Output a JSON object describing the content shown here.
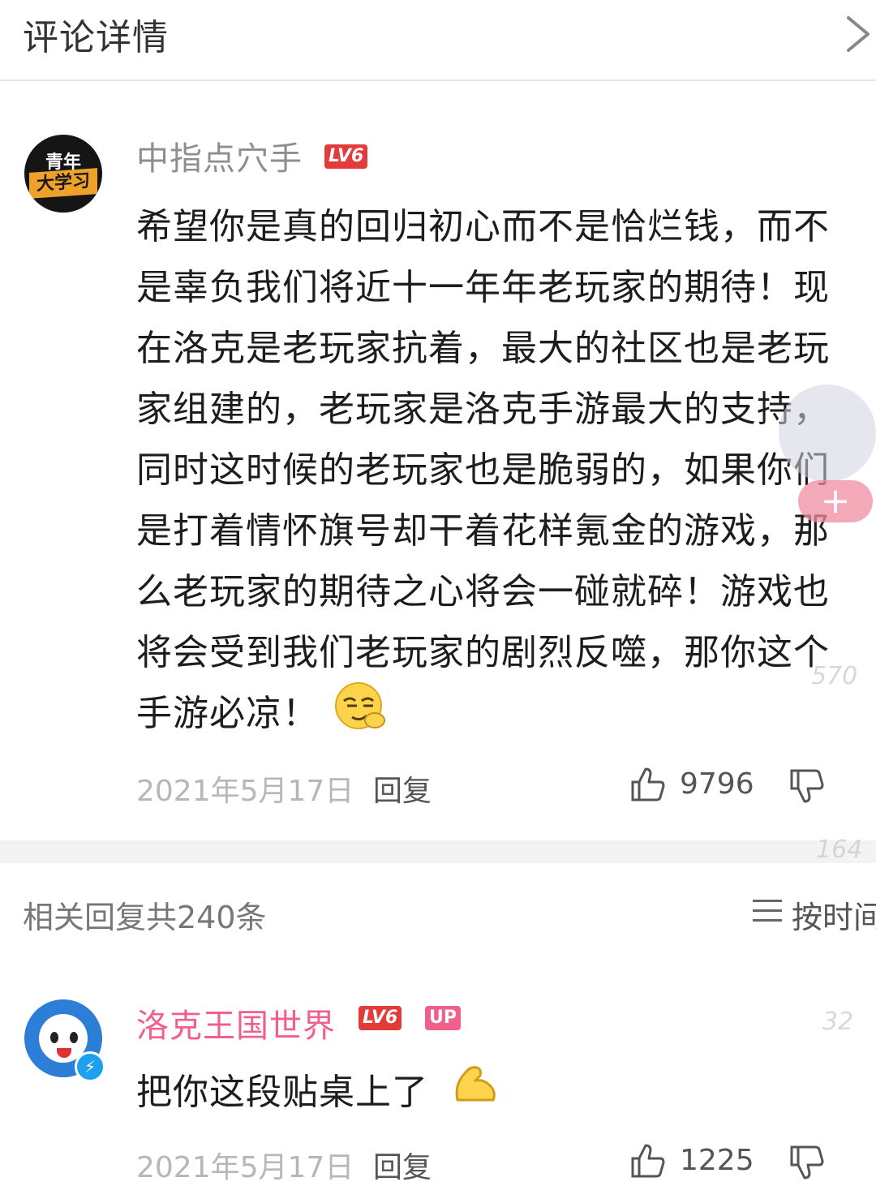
{
  "header": {
    "title": "评论详情",
    "back_icon": "chevron-right-icon"
  },
  "main_comment": {
    "avatar": {
      "top_text": "青年",
      "band_text": "大学习"
    },
    "username": "中指点穴手",
    "level_badge": "LV6",
    "lines": [
      "希望你是真的回归初心而不是恰烂钱，而不",
      "是辜负我们将近十一年年老玩家的期待！现",
      "在洛克是老玩家抗着，最大的社区也是老玩",
      "家组建的，老玩家是洛克手游最大的支持，",
      "同时这时候的老玩家也是脆弱的，如果你们",
      "是打着情怀旗号却干着花样氪金的游戏，那",
      "么老玩家的期待之心将会一碰就碎！游戏也",
      "将会受到我们老玩家的剧烈反噬，那你这个",
      "手游必凉！"
    ],
    "date": "2021年5月17日",
    "reply_label": "回复",
    "like_count": "9796"
  },
  "replies_header": {
    "count_label": "相关回复共240条",
    "sort_label": "按时间"
  },
  "reply": {
    "username": "洛克王国世界",
    "level_badge": "LV6",
    "up_badge": "UP",
    "text": "把你这段贴桌上了",
    "date": "2021年5月17日",
    "reply_label": "回复",
    "like_count": "1225"
  },
  "overlay": {
    "counters": [
      "570",
      "164",
      "32"
    ],
    "plus": "+"
  },
  "colors": {
    "accent_pink": "#f0608a",
    "badge_red": "#e33a3a",
    "muted": "#b7b7b7"
  }
}
